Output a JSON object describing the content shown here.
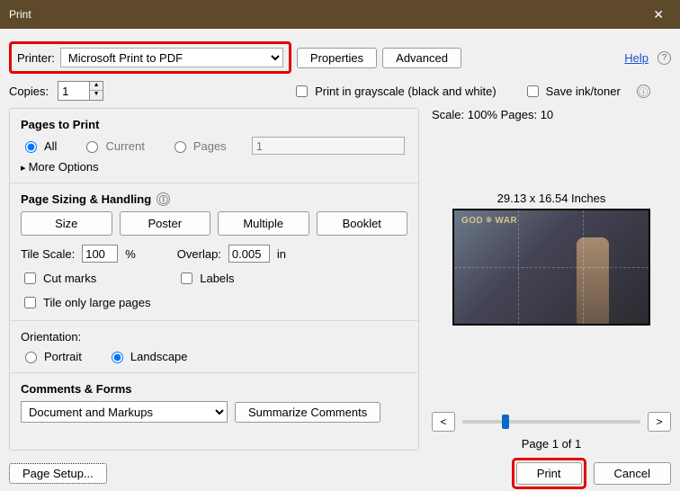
{
  "title": "Print",
  "close_glyph": "✕",
  "printer": {
    "label": "Printer:",
    "value": "Microsoft Print to PDF"
  },
  "buttons": {
    "properties": "Properties",
    "advanced": "Advanced",
    "summarize": "Summarize Comments",
    "page_setup": "Page Setup...",
    "print": "Print",
    "cancel": "Cancel"
  },
  "help": {
    "label": "Help",
    "icon": "?"
  },
  "copies": {
    "label": "Copies:",
    "value": "1"
  },
  "grayscale": "Print in grayscale (black and white)",
  "saveink": "Save ink/toner",
  "info_glyph": "ⓘ",
  "pages_to_print": {
    "title": "Pages to Print",
    "all": "All",
    "current": "Current",
    "pages": "Pages",
    "pages_value": "1",
    "more": "More Options"
  },
  "sizing": {
    "title": "Page Sizing & Handling",
    "tabs": {
      "size": "Size",
      "poster": "Poster",
      "multiple": "Multiple",
      "booklet": "Booklet"
    },
    "tile_scale_label": "Tile Scale:",
    "tile_scale": "100",
    "pct": "%",
    "overlap_label": "Overlap:",
    "overlap": "0.005",
    "in": "in",
    "cutmarks": "Cut marks",
    "labels": "Labels",
    "tileonly": "Tile only large pages"
  },
  "orientation": {
    "title": "Orientation:",
    "portrait": "Portrait",
    "landscape": "Landscape"
  },
  "comments": {
    "title": "Comments & Forms",
    "value": "Document and Markups"
  },
  "preview": {
    "scale_pages": "Scale: 100% Pages: 10",
    "dimensions": "29.13 x 16.54 Inches",
    "logo": "GOD ⍟ WAR",
    "nav_prev": "<",
    "nav_next": ">",
    "page_of": "Page 1 of 1"
  }
}
